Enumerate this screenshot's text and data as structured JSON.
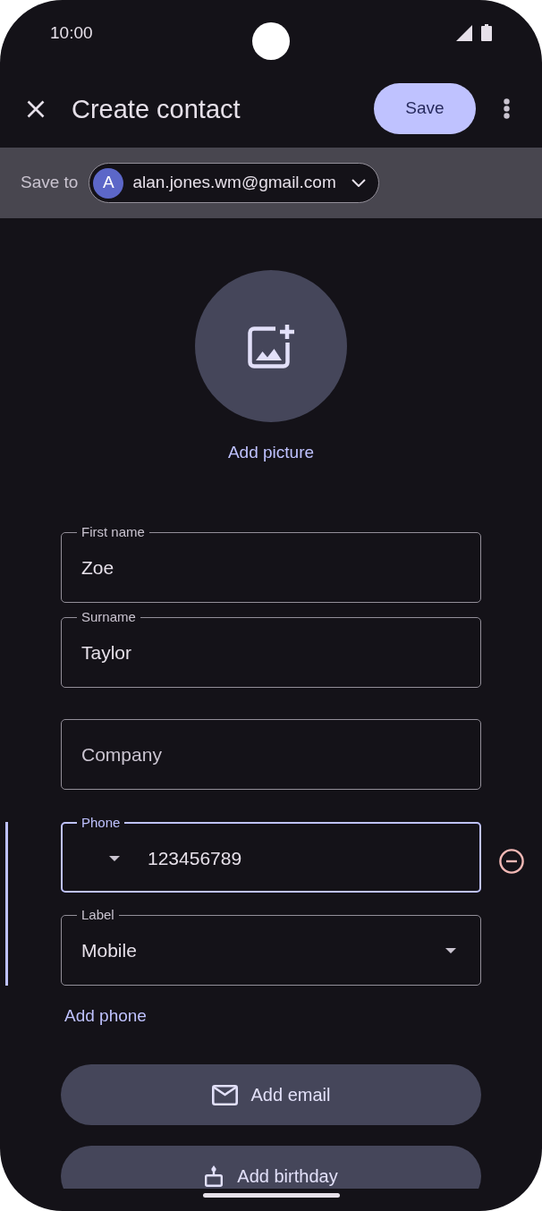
{
  "status_bar": {
    "time": "10:00"
  },
  "app_bar": {
    "title": "Create contact",
    "save_button": "Save"
  },
  "account_bar": {
    "label": "Save to",
    "account": {
      "initial": "A",
      "email": "alan.jones.wm@gmail.com"
    }
  },
  "photo": {
    "action": "Add picture"
  },
  "name_fields": [
    {
      "label": "First name",
      "value": "Zoe",
      "focused": false
    },
    {
      "label": "Surname",
      "value": "Taylor",
      "focused": false
    }
  ],
  "company_field": {
    "placeholder": "Company",
    "focused": false
  },
  "phone_section": {
    "active": true,
    "fields": [
      {
        "kind": "phone",
        "label": "Phone",
        "value": "123456789",
        "focused": true
      },
      {
        "kind": "select",
        "label": "Label",
        "value": "Mobile",
        "focused": false
      }
    ],
    "add_link": "Add phone"
  },
  "add_buttons": [
    {
      "kind": "email",
      "label": "Add email"
    },
    {
      "kind": "birthday",
      "label": "Add birthday"
    }
  ]
}
